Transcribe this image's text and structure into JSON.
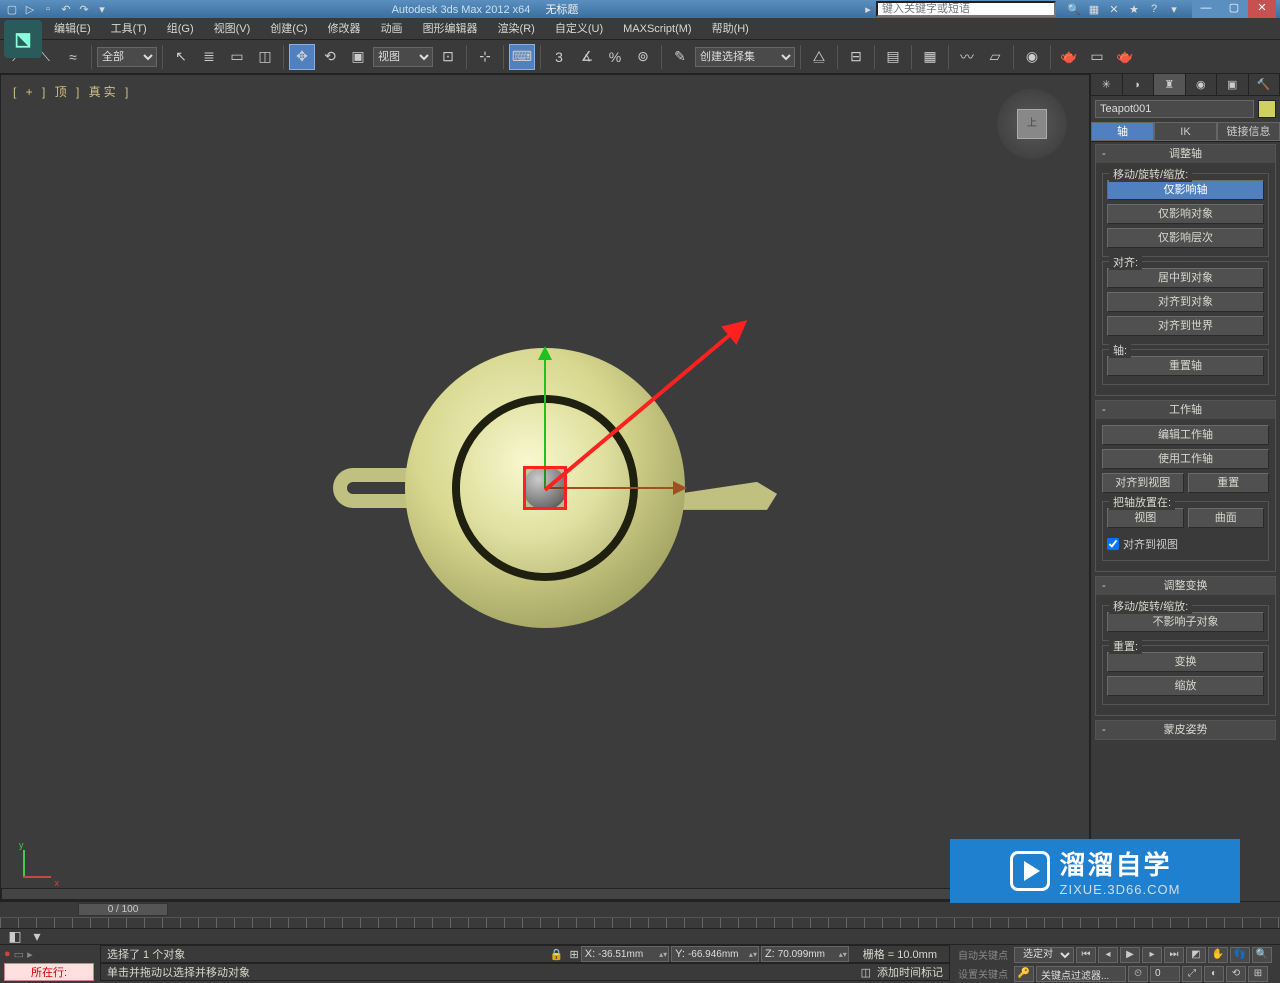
{
  "title": {
    "app": "Autodesk 3ds Max 2012 x64",
    "doc": "无标题",
    "search_placeholder": "键入关键字或短语"
  },
  "menu": {
    "edit": "编辑(E)",
    "tools": "工具(T)",
    "group": "组(G)",
    "views": "视图(V)",
    "create": "创建(C)",
    "modifiers": "修改器",
    "animation": "动画",
    "graph": "图形编辑器",
    "render": "渲染(R)",
    "customize": "自定义(U)",
    "maxscript": "MAXScript(M)",
    "help": "帮助(H)"
  },
  "toolbar": {
    "filter_all": "全部",
    "refcoord": "视图",
    "selection_set": "创建选择集",
    "angle_snap": "3"
  },
  "viewport": {
    "label": "[ + ] 顶 ] 真实 ]",
    "cube_face": "上"
  },
  "panel": {
    "object_name": "Teapot001",
    "tabs": {
      "pivot": "轴",
      "ik": "IK",
      "link": "链接信息"
    },
    "rollout_adjust_pivot": "调整轴",
    "group_move": "移动/旋转/缩放:",
    "btn_affect_pivot": "仅影响轴",
    "btn_affect_object": "仅影响对象",
    "btn_affect_hierarchy": "仅影响层次",
    "group_align": "对齐:",
    "btn_center_to_obj": "居中到对象",
    "btn_align_to_obj": "对齐到对象",
    "btn_align_to_world": "对齐到世界",
    "group_axis": "轴:",
    "btn_reset_pivot": "重置轴",
    "rollout_working_pivot": "工作轴",
    "btn_edit_wp": "编辑工作轴",
    "btn_use_wp": "使用工作轴",
    "btn_align_to_view": "对齐到视图",
    "btn_reset": "重置",
    "group_place_pivot": "把轴放置在:",
    "btn_view": "视图",
    "btn_surface": "曲面",
    "chk_align_to_view": "对齐到视图",
    "rollout_adjust_xform": "调整变换",
    "group_move2": "移动/旋转/缩放:",
    "btn_dont_affect_children": "不影响子对象",
    "group_reset": "重置:",
    "btn_xform": "变换",
    "btn_scale": "缩放",
    "rollout_skin_pose": "蒙皮姿势"
  },
  "timeline": {
    "slider": "0 / 100"
  },
  "status": {
    "selection": "选择了 1 个对象",
    "prompt": "单击并拖动以选择并移动对象",
    "x": "-36.51mm",
    "y": "-66.946mm",
    "z": "70.099mm",
    "grid": "栅格 = 10.0mm",
    "add_time_tag": "添加时间标记",
    "current_row": "所在行:",
    "auto_key": "自动关键点",
    "set_key": "设置关键点",
    "selected": "选定对",
    "key_filters": "关键点过滤器..."
  },
  "watermark": {
    "brand": "溜溜自学",
    "url": "ZIXUE.3D66.COM"
  }
}
